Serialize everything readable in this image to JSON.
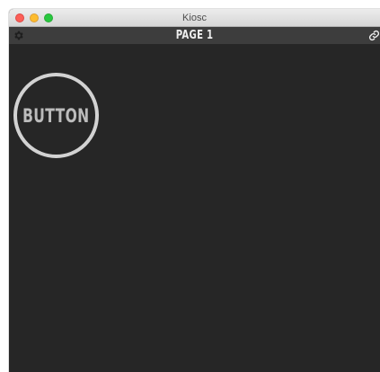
{
  "window": {
    "title": "Kiosc"
  },
  "toolbar": {
    "page_title": "PAGE 1",
    "left_icon": "gear-icon",
    "right_icon": "link-icon"
  },
  "canvas": {
    "button_label": "BUTTON"
  },
  "colors": {
    "background": "#262626",
    "toolbar": "#3d3d3d",
    "button_ring": "#d2d2d2",
    "button_text": "#bcbcbc"
  }
}
